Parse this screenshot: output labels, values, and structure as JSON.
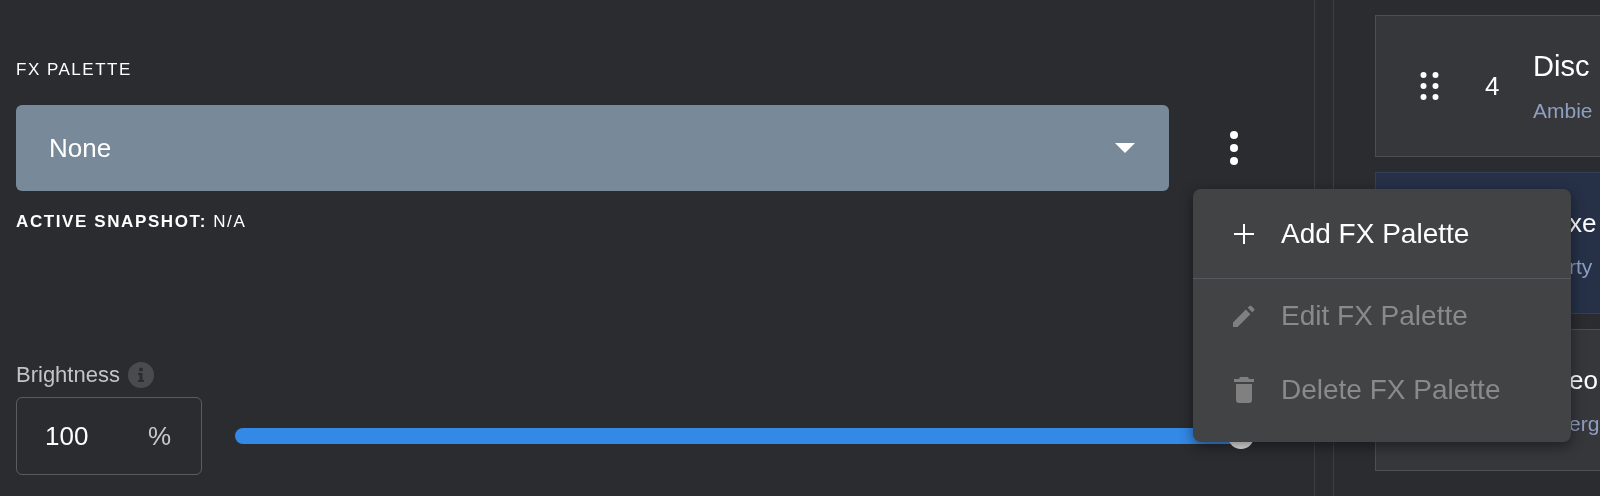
{
  "fx_palette": {
    "label": "FX PALETTE",
    "select": {
      "value": "None"
    },
    "active_snapshot": {
      "label": "ACTIVE SNAPSHOT:",
      "value": "N/A"
    }
  },
  "brightness": {
    "label": "Brightness",
    "input": {
      "value": "100",
      "unit": "%"
    },
    "slider": {
      "level": 1
    }
  },
  "cards": [
    {
      "kind": "full",
      "number": "4",
      "title": "Disc",
      "subtitle": "Ambie",
      "selected": false
    },
    {
      "kind": "covered",
      "title": "xe",
      "subtitle": "rty",
      "selected": true
    },
    {
      "kind": "covered",
      "title": "eo",
      "subtitle": "erg",
      "selected": false
    }
  ],
  "menu": {
    "items": [
      {
        "kind": "add",
        "label": "Add FX Palette",
        "disabled": false
      },
      {
        "kind": "edit",
        "label": "Edit FX Palette",
        "disabled": true
      },
      {
        "kind": "delete",
        "label": "Delete FX Palette",
        "disabled": true
      }
    ]
  }
}
